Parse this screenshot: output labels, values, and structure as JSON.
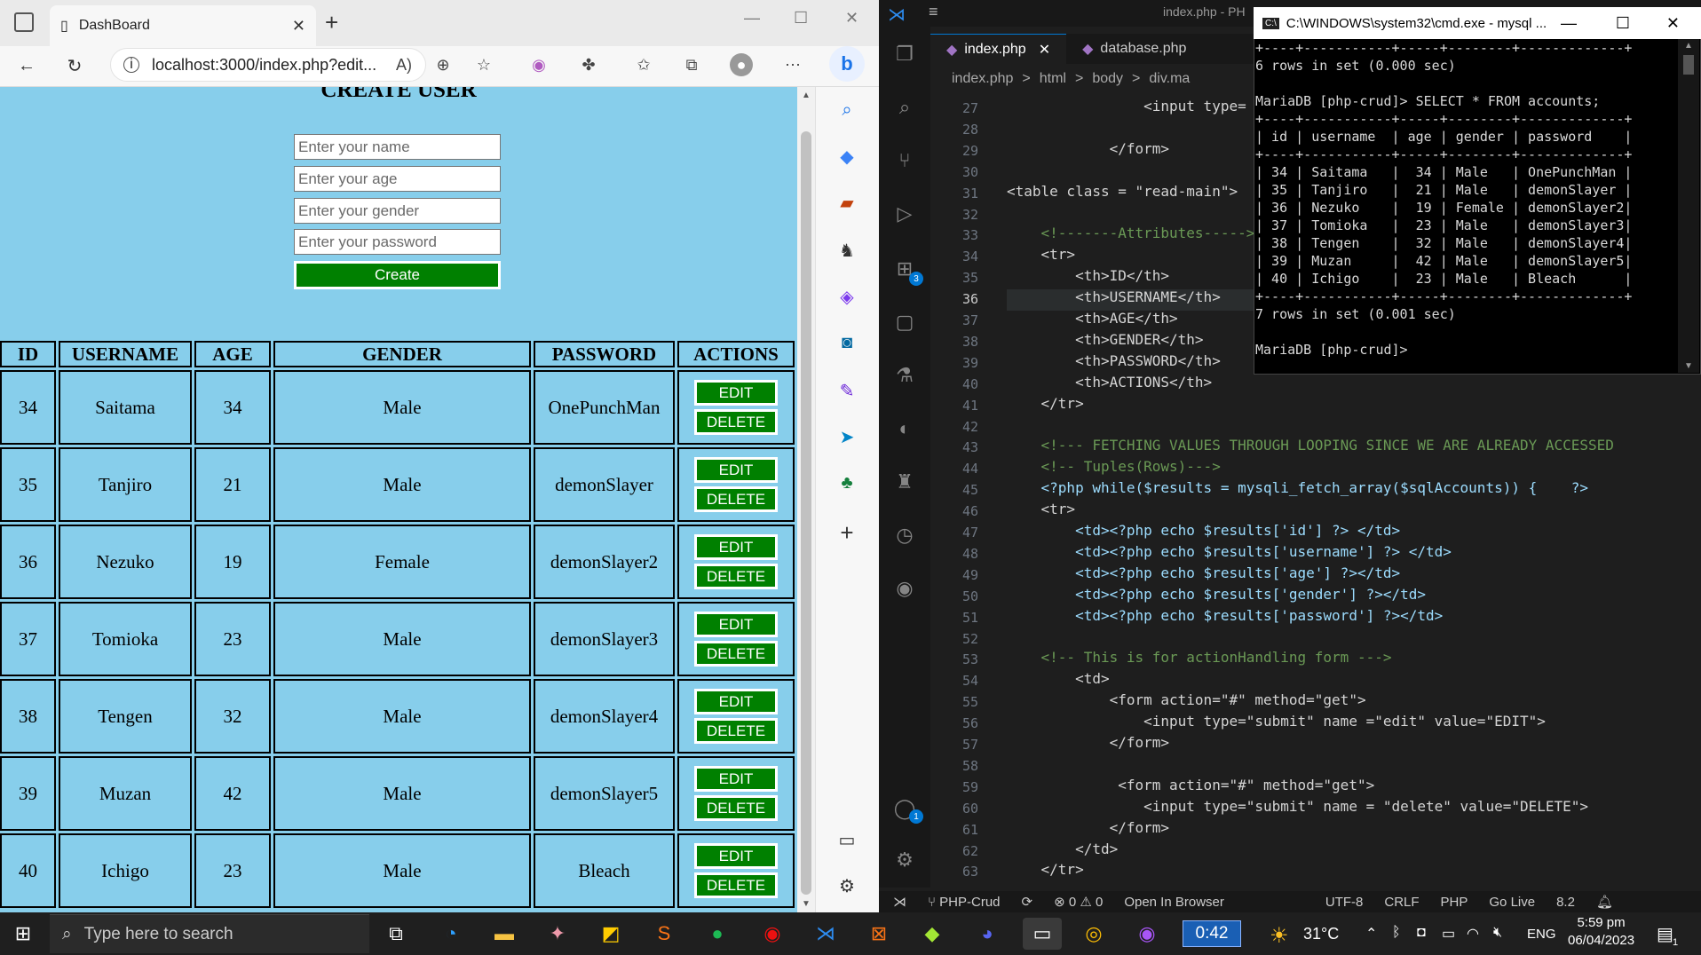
{
  "browser": {
    "tab_title": "DashBoard",
    "url": "localhost:3000/index.php?edit...",
    "tab_close": "✕",
    "new_tab": "+"
  },
  "form": {
    "title": "CREATE USER",
    "name_placeholder": "Enter your name",
    "age_placeholder": "Enter your age",
    "gender_placeholder": "Enter your gender",
    "password_placeholder": "Enter your password",
    "create_label": "Create"
  },
  "table": {
    "headers": [
      "ID",
      "USERNAME",
      "AGE",
      "GENDER",
      "PASSWORD",
      "ACTIONS"
    ],
    "edit_label": "EDIT",
    "delete_label": "DELETE",
    "rows": [
      {
        "id": "34",
        "username": "Saitama",
        "age": "34",
        "gender": "Male",
        "password": "OnePunchMan"
      },
      {
        "id": "35",
        "username": "Tanjiro",
        "age": "21",
        "gender": "Male",
        "password": "demonSlayer"
      },
      {
        "id": "36",
        "username": "Nezuko",
        "age": "19",
        "gender": "Female",
        "password": "demonSlayer2"
      },
      {
        "id": "37",
        "username": "Tomioka",
        "age": "23",
        "gender": "Male",
        "password": "demonSlayer3"
      },
      {
        "id": "38",
        "username": "Tengen",
        "age": "32",
        "gender": "Male",
        "password": "demonSlayer4"
      },
      {
        "id": "39",
        "username": "Muzan",
        "age": "42",
        "gender": "Male",
        "password": "demonSlayer5"
      },
      {
        "id": "40",
        "username": "Ichigo",
        "age": "23",
        "gender": "Male",
        "password": "Bleach"
      }
    ]
  },
  "vscode": {
    "window_title": "index.php - PH",
    "tabs": [
      "index.php",
      "database.php"
    ],
    "breadcrumbs": [
      "index.php",
      ">",
      "html",
      ">",
      "body",
      ">",
      "div.ma"
    ],
    "line_numbers": [
      "27",
      "28",
      "29",
      "30",
      "31",
      "32",
      "33",
      "34",
      "35",
      "36",
      "37",
      "38",
      "39",
      "40",
      "41",
      "42",
      "43",
      "44",
      "45",
      "46",
      "47",
      "48",
      "49",
      "50",
      "51",
      "52",
      "53",
      "54",
      "55",
      "56",
      "57",
      "58",
      "59",
      "60",
      "61",
      "62",
      "63"
    ],
    "code_lines": [
      "                <input type=",
      "",
      "            </form>",
      "",
      "<table class = \"read-main\">",
      "",
      "    <!-------Attributes----->",
      "    <tr>",
      "        <th>ID</th>",
      "        <th>USERNAME</th>",
      "        <th>AGE</th>",
      "        <th>GENDER</th>",
      "        <th>PASSWORD</th>",
      "        <th>ACTIONS</th>",
      "    </tr>",
      "",
      "    <!--- FETCHING VALUES THROUGH LOOPING SINCE WE ARE ALREADY ACCESSED",
      "    <!-- Tuples(Rows)--->",
      "    <?php while($results = mysqli_fetch_array($sqlAccounts)) {    ?>",
      "    <tr>",
      "        <td><?php echo $results['id'] ?> </td>",
      "        <td><?php echo $results['username'] ?> </td>",
      "        <td><?php echo $results['age'] ?></td>",
      "        <td><?php echo $results['gender'] ?></td>",
      "        <td><?php echo $results['password'] ?></td>",
      "",
      "    <!-- This is for actionHandling form --->",
      "        <td>",
      "            <form action=\"#\" method=\"get\">",
      "                <input type=\"submit\" name =\"edit\" value=\"EDIT\">",
      "            </form>",
      "",
      "             <form action=\"#\" method=\"get\">",
      "                <input type=\"submit\" name = \"delete\" value=\"DELETE\">",
      "            </form>",
      "        </td>",
      "    </tr>"
    ],
    "status": {
      "branch": "PHP-Crud",
      "problems": "⊗ 0 ⚠ 0",
      "open_in_browser": "Open In Browser",
      "encoding": "UTF-8",
      "eol": "CRLF",
      "language": "PHP",
      "golive": "Go Live",
      "version": "8.2"
    },
    "badge_extensions": "3",
    "badge_accounts": "1"
  },
  "cmd": {
    "title": "C:\\WINDOWS\\system32\\cmd.exe - mysql ...",
    "output": "+----+-----------+-----+--------+-------------+\n6 rows in set (0.000 sec)\n\nMariaDB [php-crud]> SELECT * FROM accounts;\n+----+-----------+-----+--------+-------------+\n| id | username  | age | gender | password    |\n+----+-----------+-----+--------+-------------+\n| 34 | Saitama   |  34 | Male   | OnePunchMan |\n| 35 | Tanjiro   |  21 | Male   | demonSlayer |\n| 36 | Nezuko    |  19 | Female | demonSlayer2|\n| 37 | Tomioka   |  23 | Male   | demonSlayer3|\n| 38 | Tengen    |  32 | Male   | demonSlayer4|\n| 39 | Muzan     |  42 | Male   | demonSlayer5|\n| 40 | Ichigo    |  23 | Male   | Bleach      |\n+----+-----------+-----+--------+-------------+\n7 rows in set (0.001 sec)\n\nMariaDB [php-crud]>"
  },
  "taskbar": {
    "search_placeholder": "Type here to search",
    "timer": "0:42",
    "temperature": "31°C",
    "language": "ENG",
    "time": "5:59 pm",
    "date": "06/04/2023",
    "notification_count": "1"
  }
}
